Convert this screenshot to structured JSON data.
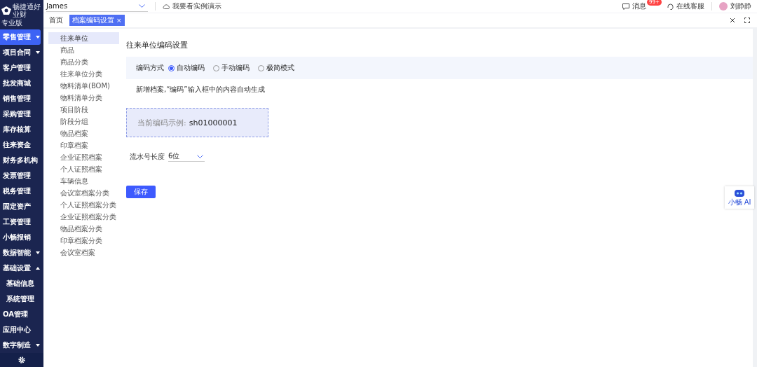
{
  "sidebar": {
    "logo_text": "畅捷通好业财",
    "edition": "专业版",
    "items": [
      {
        "label": "零售管理",
        "kind": "folder",
        "expanded": false,
        "selected": true
      },
      {
        "label": "项目合同",
        "kind": "folder",
        "expanded": false,
        "selected": false
      },
      {
        "label": "客户管理",
        "kind": "leaf",
        "selected": false
      },
      {
        "label": "批发商城",
        "kind": "leaf",
        "selected": false
      },
      {
        "label": "销售管理",
        "kind": "leaf",
        "selected": false
      },
      {
        "label": "采购管理",
        "kind": "leaf",
        "selected": false
      },
      {
        "label": "库存核算",
        "kind": "leaf",
        "selected": false
      },
      {
        "label": "往来资金",
        "kind": "leaf",
        "selected": false
      },
      {
        "label": "财务多机构",
        "kind": "leaf",
        "selected": false
      },
      {
        "label": "发票管理",
        "kind": "leaf",
        "selected": false
      },
      {
        "label": "税务管理",
        "kind": "leaf",
        "selected": false
      },
      {
        "label": "固定资产",
        "kind": "leaf",
        "selected": false
      },
      {
        "label": "工资管理",
        "kind": "leaf",
        "selected": false
      },
      {
        "label": "小畅报销",
        "kind": "leaf",
        "selected": false
      },
      {
        "label": "数据智能",
        "kind": "folder",
        "expanded": false,
        "selected": false
      },
      {
        "label": "基础设置",
        "kind": "folder",
        "expanded": true,
        "selected": false,
        "children": [
          {
            "label": "基础信息",
            "selected": false
          },
          {
            "label": "系统管理",
            "selected": false
          }
        ]
      },
      {
        "label": "OA管理",
        "kind": "leaf",
        "selected": false
      },
      {
        "label": "应用中心",
        "kind": "leaf",
        "selected": false
      },
      {
        "label": "数字制造",
        "kind": "folder",
        "expanded": false,
        "selected": false
      }
    ]
  },
  "top_bar": {
    "company": "James",
    "demo_link": "我要看实例演示",
    "messages": "消息",
    "message_badge": "99+",
    "support": "在线客服",
    "user": "刘静静"
  },
  "tabs": [
    {
      "label": "首页",
      "selected": false
    },
    {
      "label": "档案编码设置",
      "selected": true,
      "close": "×"
    }
  ],
  "sub_nav": [
    {
      "label": "往来单位",
      "selected": true
    },
    {
      "label": "商品",
      "selected": false
    },
    {
      "label": "商品分类",
      "selected": false
    },
    {
      "label": "往来单位分类",
      "selected": false
    },
    {
      "label": "物料清单(BOM)",
      "selected": false
    },
    {
      "label": "物料清单分类",
      "selected": false
    },
    {
      "label": "项目阶段",
      "selected": false
    },
    {
      "label": "阶段分组",
      "selected": false
    },
    {
      "label": "物品档案",
      "selected": false
    },
    {
      "label": "印章档案",
      "selected": false
    },
    {
      "label": "企业证照档案",
      "selected": false
    },
    {
      "label": "个人证照档案",
      "selected": false
    },
    {
      "label": "车辆信息",
      "selected": false
    },
    {
      "label": "会议室档案分类",
      "selected": false
    },
    {
      "label": "个人证照档案分类",
      "selected": false
    },
    {
      "label": "企业证照档案分类",
      "selected": false
    },
    {
      "label": "物品档案分类",
      "selected": false
    },
    {
      "label": "印章档案分类",
      "selected": false
    },
    {
      "label": "会议室档案",
      "selected": false
    }
  ],
  "page": {
    "title": "往来单位编码设置",
    "coding_label": "编码方式",
    "coding_options": [
      {
        "label": "自动编码",
        "selected": true
      },
      {
        "label": "手动编码",
        "selected": false
      },
      {
        "label": "极简模式",
        "selected": false
      }
    ],
    "hint": "新增档案,“编码”输入框中的内容自动生成",
    "example_label": "当前编码示例:",
    "example_value": "sh01000001",
    "serial_label": "流水号长度",
    "serial_value": "6位",
    "save": "保存"
  },
  "assistant": {
    "label": "小畅 AI"
  }
}
